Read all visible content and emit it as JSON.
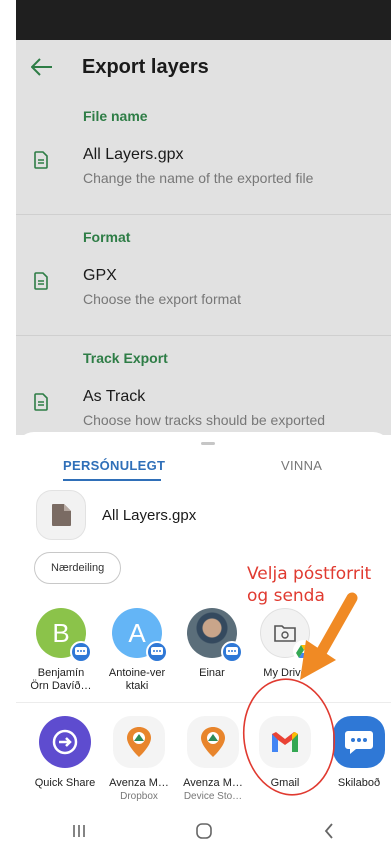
{
  "screen": {
    "title": "Export layers",
    "back_icon": "arrow-left-icon",
    "sections": [
      {
        "header": "File name",
        "title": "All Layers.gpx",
        "subtitle": "Change the name of the exported file",
        "icon": "document-icon"
      },
      {
        "header": "Format",
        "title": "GPX",
        "subtitle": "Choose the export format",
        "icon": "document-icon"
      },
      {
        "header": "Track Export",
        "title": "As Track",
        "subtitle": "Choose how tracks should be exported",
        "icon": "document-icon"
      }
    ]
  },
  "share_sheet": {
    "tabs": {
      "personal": "PERSÓNULEGT",
      "work": "VINNA"
    },
    "file_name": "All Layers.gpx",
    "chip": "Nærdeiling",
    "contacts": [
      {
        "name": "Benjamín\nÖrn Davíð…",
        "initial": "B",
        "color": "#8bc34a",
        "icon": "message-badge-icon"
      },
      {
        "name": "Antoine-ver\nktaki",
        "initial": "A",
        "color": "#64b5f6",
        "icon": "message-badge-icon"
      },
      {
        "name": "Einar",
        "initial": "",
        "color": "#5b6e7a",
        "icon": "message-badge-icon"
      },
      {
        "name": "My Drive",
        "initial": "",
        "color": "#f2f2f2",
        "icon": "folder-drive-icon"
      }
    ],
    "apps": [
      {
        "label": "Quick Share",
        "sub": "",
        "icon": "quick-share-icon",
        "color": "#5e4ccf"
      },
      {
        "label": "Avenza M…",
        "sub": "Dropbox",
        "icon": "avenza-icon",
        "color": "#f4f4f4"
      },
      {
        "label": "Avenza M…",
        "sub": "Device Sto…",
        "icon": "avenza-icon",
        "color": "#f4f4f4"
      },
      {
        "label": "Gmail",
        "sub": "",
        "icon": "gmail-icon",
        "color": "#f4f4f4"
      },
      {
        "label": "Skilaboð",
        "sub": "",
        "icon": "messages-icon",
        "color": "#2f78d6"
      }
    ]
  },
  "annotation": {
    "line1": "Velja póstforrit",
    "line2": "og senda",
    "color": "#e03a30"
  },
  "nav": {
    "recents": "recents-icon",
    "home": "home-icon",
    "back": "back-chevron-icon"
  },
  "colors": {
    "accent": "#2e7d46",
    "tab_active": "#2f6fb8",
    "arrow": "#f08a24"
  }
}
